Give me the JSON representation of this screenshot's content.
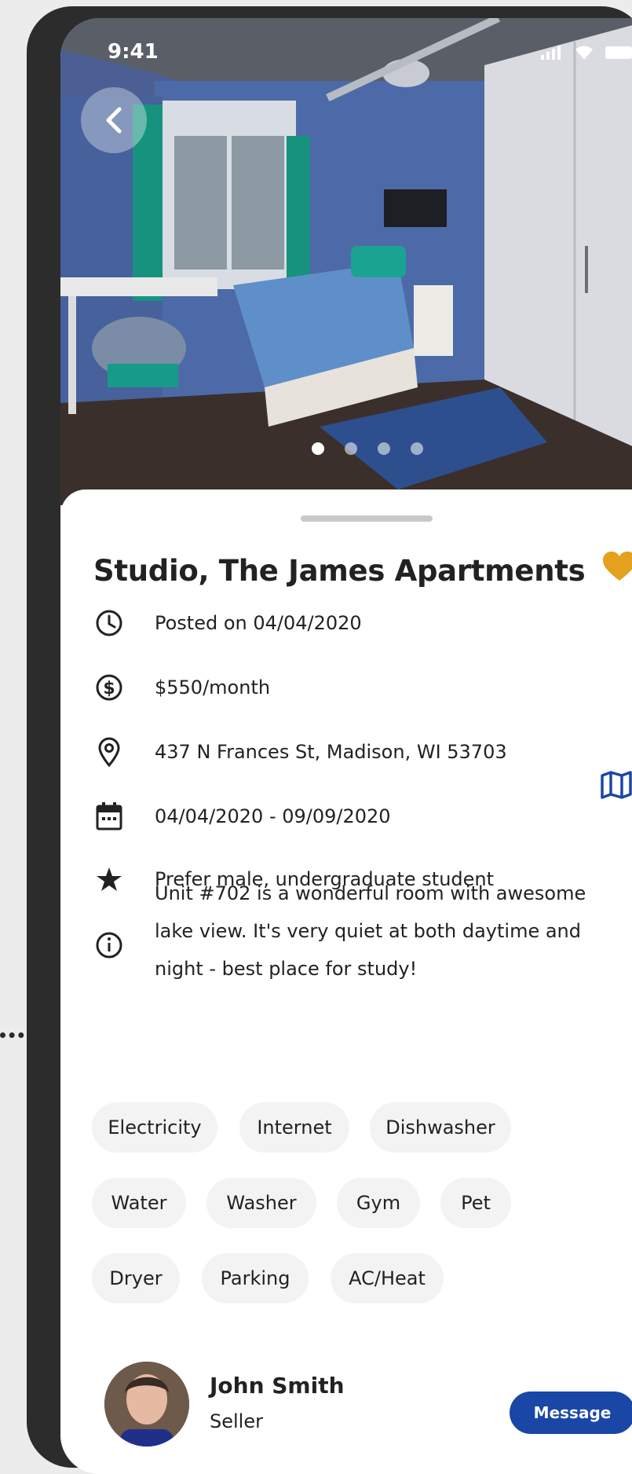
{
  "status": {
    "time": "9:41"
  },
  "listing": {
    "title": "Studio, The James Apartments",
    "posted": "Posted on 04/04/2020",
    "price": "$550/month",
    "address": "437 N Frances St, Madison, WI 53703",
    "dates": "04/04/2020 - 09/09/2020",
    "preference": "Prefer male, undergraduate student",
    "description": "Unit #702 is a wonderful room with awesome lake view. It's very quiet at both daytime and night - best place for study!"
  },
  "gallery": {
    "page_count": 4,
    "active_index": 0
  },
  "amenities": [
    "Electricity",
    "Internet",
    "Dishwasher",
    "Water",
    "Washer",
    "Gym",
    "Pet",
    "Dryer",
    "Parking",
    "AC/Heat"
  ],
  "seller": {
    "name": "John Smith",
    "role": "Seller",
    "message_label": "Message"
  },
  "colors": {
    "accent": "#1a47a6",
    "favorite": "#e3a11e",
    "chip_bg": "#f3f3f3"
  },
  "icons": {
    "back": "chevron-left-icon",
    "favorite": "heart-icon",
    "posted": "clock-icon",
    "price": "dollar-icon",
    "address": "location-pin-icon",
    "map": "map-icon",
    "dates": "calendar-icon",
    "preference": "star-icon",
    "description": "info-icon"
  }
}
